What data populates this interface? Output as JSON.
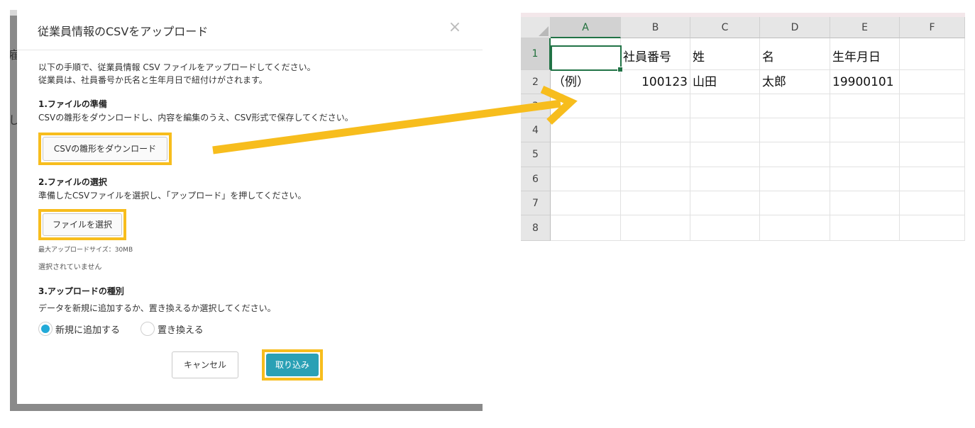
{
  "background": {
    "fragment_left_a": "雇",
    "fragment_left_b": "し"
  },
  "modal": {
    "title": "従業員情報のCSVをアップロード",
    "close_glyph": "×",
    "intro_line1": "以下の手順で、従業員情報 CSV ファイルをアップロードしてください。",
    "intro_line2": "従業員は、社員番号か氏名と生年月日で紐付けがされます。",
    "step1": {
      "heading": "1.ファイルの準備",
      "desc": "CSVの雛形をダウンロードし、内容を編集のうえ、CSV形式で保存してください。",
      "download_button": "CSVの雛形をダウンロード"
    },
    "step2": {
      "heading": "2.ファイルの選択",
      "desc": "準備したCSVファイルを選択し、「アップロード」を押してください。",
      "select_button": "ファイルを選択",
      "max_size": "最大アップロードサイズ：30MB",
      "file_status": "選択されていません"
    },
    "step3": {
      "heading": "3.アップロードの種別",
      "desc": "データを新規に追加するか、置き換えるか選択してください。",
      "options": [
        {
          "label": "新規に追加する",
          "selected": true
        },
        {
          "label": "置き換える",
          "selected": false
        }
      ]
    },
    "cancel_button": "キャンセル",
    "import_button": "取り込み"
  },
  "colors": {
    "highlight": "#f7bd1d",
    "arrow": "#f7bd1d",
    "import_button_bg": "#2aa0b5",
    "radio_selected": "#22aad8",
    "sheet_accent": "#217346"
  },
  "spreadsheet": {
    "columns": [
      "A",
      "B",
      "C",
      "D",
      "E",
      "F"
    ],
    "rows": [
      "1",
      "2",
      "3",
      "4",
      "5",
      "6",
      "7",
      "8"
    ],
    "selected_cell": "A1",
    "row1": [
      "",
      "社員番号",
      "姓",
      "名",
      "生年月日",
      ""
    ],
    "row2": [
      "（例）",
      "100123",
      "山田",
      "太郎",
      "19900101",
      ""
    ]
  }
}
